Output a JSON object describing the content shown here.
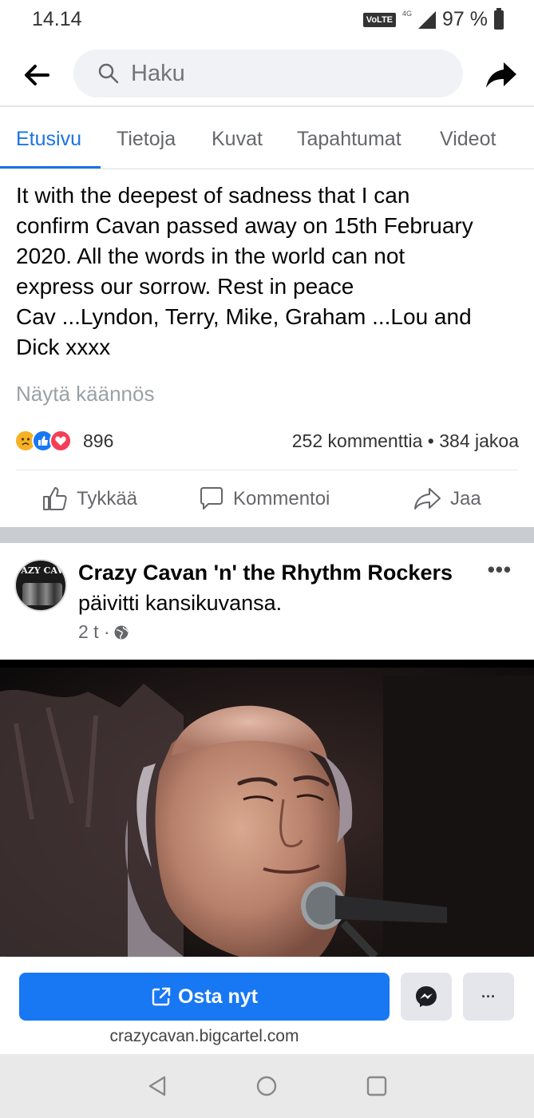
{
  "status_bar": {
    "time": "14.14",
    "volte": "VoLTE",
    "network": "4G",
    "battery": "97 %"
  },
  "header": {
    "search_placeholder": "Haku"
  },
  "tabs": [
    {
      "label": "Etusivu",
      "active": true
    },
    {
      "label": "Tietoja",
      "active": false
    },
    {
      "label": "Kuvat",
      "active": false
    },
    {
      "label": "Tapahtumat",
      "active": false
    },
    {
      "label": "Videot",
      "active": false
    }
  ],
  "post": {
    "text": "It with the deepest of  sadness that I can\nconfirm Cavan passed away on 15th February\n2020. All the words in the world can not\nexpress our sorrow. Rest in peace\nCav ...Lyndon, Terry, Mike, Graham ...Lou and\nDick xxxx",
    "translate_label": "Näytä käännös",
    "reactions": {
      "types": [
        "sad",
        "like",
        "love"
      ],
      "count": "896",
      "stats": "252 kommenttia • 384 jakoa"
    },
    "actions": {
      "like": "Tykkää",
      "comment": "Kommentoi",
      "share": "Jaa"
    }
  },
  "post2": {
    "page_name": "Crazy Cavan 'n' the Rhythm Rockers",
    "action": "päivitti kansikuvansa.",
    "time": "2 t ·",
    "avatar_text": "AZY CAV"
  },
  "cta": {
    "button_label": "Osta nyt",
    "url": "crazycavan.bigcartel.com",
    "more_label": "···"
  },
  "colors": {
    "accent": "#1877f2",
    "tab_active": "#1b74e4",
    "muted": "#65676b"
  }
}
